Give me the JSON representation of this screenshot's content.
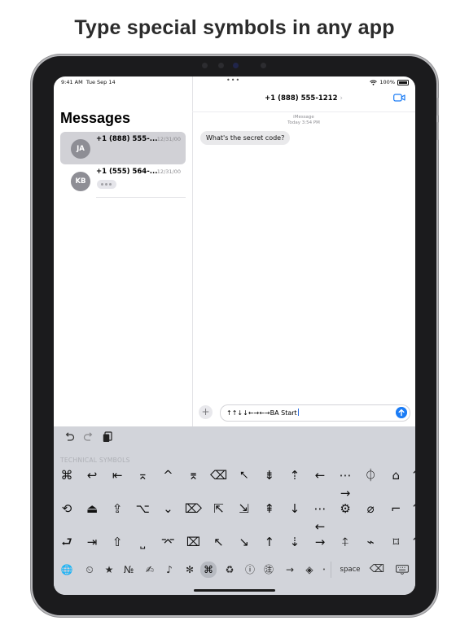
{
  "headline": "Type special symbols in any app",
  "status": {
    "time": "9:41 AM",
    "date": "Tue Sep 14",
    "battery": "100%"
  },
  "sidebar": {
    "title": "Messages",
    "conversations": [
      {
        "initials": "JA",
        "name": "+1 (888) 555-...",
        "date": "12/31/00",
        "selected": true
      },
      {
        "initials": "KB",
        "name": "+1 (555) 564-...",
        "date": "12/31/00",
        "typing": true
      }
    ]
  },
  "chat": {
    "header_number": "+1 (888) 555-1212",
    "service": "iMessage",
    "timestamp": "Today 3:54 PM",
    "messages": [
      {
        "text": "What's the secret code?",
        "incoming": true
      }
    ],
    "input_value": "↑↑↓↓←→←→BA Start"
  },
  "keyboard": {
    "section_label": "TECHNICAL SYMBOLS",
    "rows": [
      [
        "⌘",
        "↩",
        "⇤",
        "⌅",
        "^",
        "⌆",
        "⌫",
        "⭦",
        "⇟",
        "⇡",
        "←",
        "⋯→",
        "⏀",
        "⌂",
        "⌃"
      ],
      [
        "⟲",
        "⏏",
        "⇪",
        "⌥",
        "⌄",
        "⌦",
        "⇱",
        "⇲",
        "⇞",
        "↓",
        "⋯←",
        "⚙",
        "⌀",
        "⌐",
        "⌃"
      ],
      [
        "⮐",
        "⇥",
        "⇧",
        "⎵",
        "⌤",
        "⌧",
        "↖",
        "↘",
        "↑",
        "⇣",
        "→",
        "⍏",
        "⌁",
        "⌑",
        "⌃"
      ]
    ],
    "categories": [
      "🌐",
      "⏲",
      "★",
      "№",
      "✍",
      "♪",
      "✻",
      "⌘",
      "♻",
      "ⓘ",
      "㊟",
      "→",
      "◈",
      "•"
    ],
    "space_label": "space",
    "backspace": "⌫"
  },
  "colors": {
    "accent": "#1b7cf5",
    "keyboard_bg": "#d2d4da",
    "selected_row": "#d1d1d6"
  }
}
